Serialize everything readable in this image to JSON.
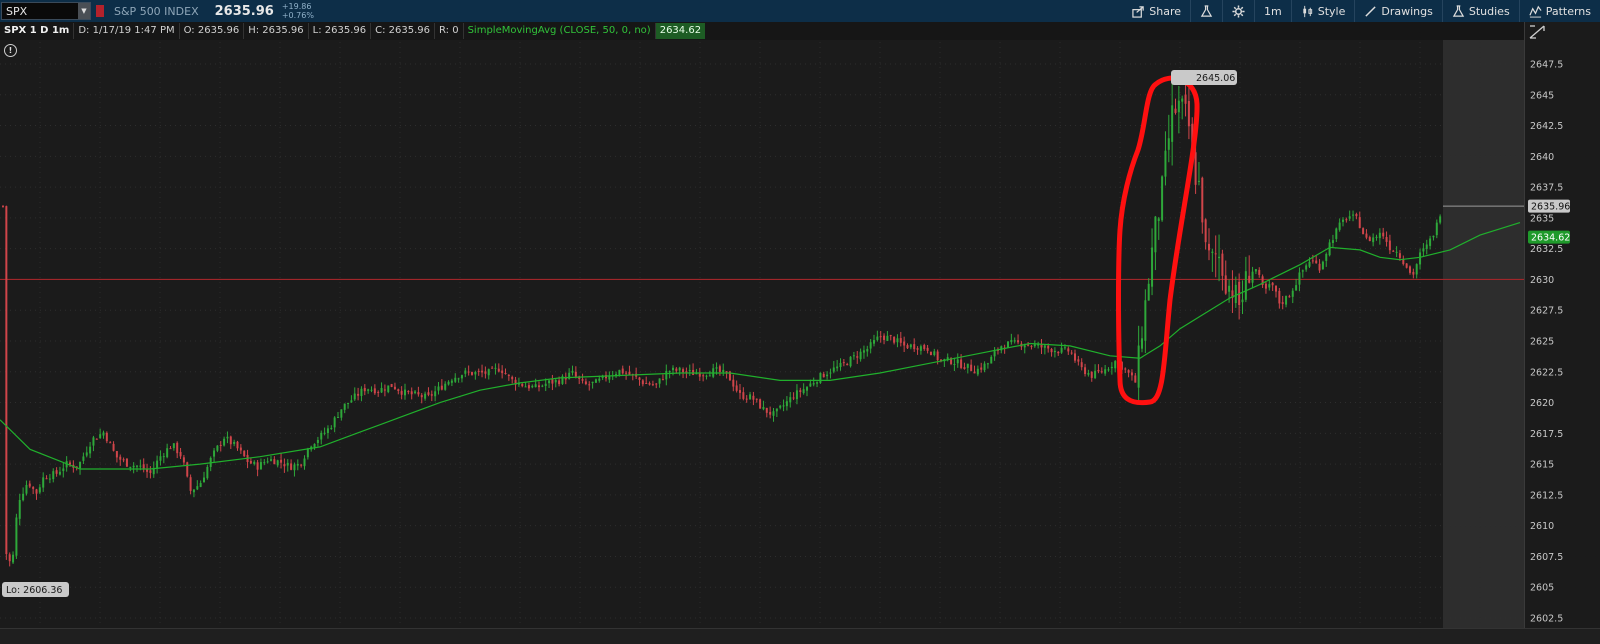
{
  "toolbar": {
    "symbol": "SPX",
    "index_name": "S&P 500 INDEX",
    "price": "2635.96",
    "change_abs": "+19.86",
    "change_pct": "+0.76%",
    "buttons": {
      "share": "Share",
      "interval": "1m",
      "style": "Style",
      "drawings": "Drawings",
      "studies": "Studies",
      "patterns": "Patterns"
    }
  },
  "infobar": {
    "title": "SPX 1 D 1m",
    "date": "D: 1/17/19 1:47 PM",
    "open": "O: 2635.96",
    "high": "H: 2635.96",
    "low": "L: 2635.96",
    "close": "C: 2635.96",
    "range": "R: 0",
    "study_label": "SimpleMovingAvg (CLOSE, 50, 0, no)",
    "study_value": "2634.62"
  },
  "info_icon": "!",
  "colors": {
    "up": "#2ea83a",
    "down": "#d0454a",
    "sma": "#20b02c",
    "hline": "#a0262a",
    "annotation": "#ff1010",
    "last_price_tag": "#c9c9c9",
    "sma_tag": "#1f9a2b"
  },
  "chart_data": {
    "type": "candlestick",
    "y_ticks": [
      "2647.5",
      "2645",
      "2642.5",
      "2640",
      "2637.5",
      "2635",
      "2632.5",
      "2630",
      "2627.5",
      "2625",
      "2622.5",
      "2620",
      "2617.5",
      "2615",
      "2612.5",
      "2610",
      "2607.5",
      "2605",
      "2602.5"
    ],
    "ylim": [
      2602.5,
      2647.5
    ],
    "high_label": "2645.06",
    "low_label": "Lo: 2606.36",
    "last_price_label": "2635.96",
    "sma_label": "2634.62",
    "horizontal_line": 2630,
    "sma_series": [
      [
        0,
        2618.6
      ],
      [
        30,
        2616.2
      ],
      [
        80,
        2614.6
      ],
      [
        150,
        2614.6
      ],
      [
        200,
        2615.0
      ],
      [
        260,
        2615.6
      ],
      [
        320,
        2616.4
      ],
      [
        360,
        2617.6
      ],
      [
        400,
        2618.8
      ],
      [
        440,
        2620.0
      ],
      [
        480,
        2621.0
      ],
      [
        520,
        2621.6
      ],
      [
        560,
        2622.0
      ],
      [
        620,
        2622.2
      ],
      [
        680,
        2622.4
      ],
      [
        730,
        2622.4
      ],
      [
        780,
        2621.8
      ],
      [
        830,
        2621.8
      ],
      [
        880,
        2622.4
      ],
      [
        930,
        2623.2
      ],
      [
        980,
        2624.0
      ],
      [
        1030,
        2624.8
      ],
      [
        1070,
        2624.6
      ],
      [
        1110,
        2623.8
      ],
      [
        1140,
        2623.6
      ],
      [
        1160,
        2624.6
      ],
      [
        1180,
        2626.0
      ],
      [
        1200,
        2627.0
      ],
      [
        1230,
        2628.5
      ],
      [
        1260,
        2629.6
      ],
      [
        1300,
        2631.2
      ],
      [
        1330,
        2632.6
      ],
      [
        1360,
        2632.4
      ],
      [
        1380,
        2631.8
      ],
      [
        1400,
        2631.6
      ],
      [
        1420,
        2631.8
      ],
      [
        1450,
        2632.4
      ],
      [
        1480,
        2633.6
      ],
      [
        1520,
        2634.62
      ]
    ],
    "price_path": [
      [
        5,
        2608
      ],
      [
        12,
        2606.6
      ],
      [
        18,
        2612
      ],
      [
        28,
        2613.6
      ],
      [
        36,
        2612.6
      ],
      [
        44,
        2614.0
      ],
      [
        56,
        2614.2
      ],
      [
        66,
        2615.0
      ],
      [
        78,
        2614.8
      ],
      [
        92,
        2617.0
      ],
      [
        104,
        2617.6
      ],
      [
        116,
        2615.6
      ],
      [
        128,
        2615.0
      ],
      [
        140,
        2614.8
      ],
      [
        150,
        2614.2
      ],
      [
        160,
        2615.6
      ],
      [
        172,
        2616.6
      ],
      [
        182,
        2615.6
      ],
      [
        190,
        2612.8
      ],
      [
        200,
        2613.4
      ],
      [
        212,
        2615.6
      ],
      [
        224,
        2617.2
      ],
      [
        236,
        2616.4
      ],
      [
        248,
        2615.2
      ],
      [
        258,
        2614.8
      ],
      [
        268,
        2615.4
      ],
      [
        280,
        2615.2
      ],
      [
        290,
        2614.8
      ],
      [
        300,
        2615.0
      ],
      [
        310,
        2616.6
      ],
      [
        320,
        2617.2
      ],
      [
        330,
        2618.0
      ],
      [
        342,
        2619.6
      ],
      [
        354,
        2620.4
      ],
      [
        366,
        2621.2
      ],
      [
        378,
        2621.0
      ],
      [
        392,
        2621.4
      ],
      [
        404,
        2620.8
      ],
      [
        416,
        2620.6
      ],
      [
        428,
        2620.4
      ],
      [
        440,
        2621.2
      ],
      [
        452,
        2622.0
      ],
      [
        464,
        2622.4
      ],
      [
        476,
        2622.4
      ],
      [
        488,
        2622.4
      ],
      [
        500,
        2622.8
      ],
      [
        512,
        2621.8
      ],
      [
        524,
        2621.4
      ],
      [
        536,
        2621.2
      ],
      [
        548,
        2621.6
      ],
      [
        560,
        2621.8
      ],
      [
        572,
        2622.4
      ],
      [
        584,
        2621.4
      ],
      [
        596,
        2621.6
      ],
      [
        608,
        2622.2
      ],
      [
        620,
        2622.6
      ],
      [
        632,
        2622.2
      ],
      [
        644,
        2621.6
      ],
      [
        656,
        2621.4
      ],
      [
        668,
        2622.6
      ],
      [
        680,
        2622.6
      ],
      [
        692,
        2622.4
      ],
      [
        704,
        2622.4
      ],
      [
        716,
        2622.6
      ],
      [
        728,
        2622.2
      ],
      [
        740,
        2620.6
      ],
      [
        752,
        2620.4
      ],
      [
        764,
        2619.4
      ],
      [
        774,
        2619.0
      ],
      [
        784,
        2619.8
      ],
      [
        794,
        2620.6
      ],
      [
        806,
        2621.2
      ],
      [
        818,
        2622.0
      ],
      [
        830,
        2622.6
      ],
      [
        842,
        2623.0
      ],
      [
        856,
        2623.8
      ],
      [
        868,
        2624.4
      ],
      [
        880,
        2625.4
      ],
      [
        892,
        2625.2
      ],
      [
        904,
        2624.6
      ],
      [
        916,
        2624.6
      ],
      [
        928,
        2624.4
      ],
      [
        940,
        2623.4
      ],
      [
        952,
        2623.4
      ],
      [
        964,
        2623.0
      ],
      [
        976,
        2622.6
      ],
      [
        988,
        2623.2
      ],
      [
        1000,
        2624.6
      ],
      [
        1012,
        2624.8
      ],
      [
        1024,
        2624.8
      ],
      [
        1036,
        2624.6
      ],
      [
        1048,
        2624.4
      ],
      [
        1060,
        2624.2
      ],
      [
        1070,
        2624.2
      ],
      [
        1080,
        2622.8
      ],
      [
        1092,
        2622.2
      ],
      [
        1104,
        2622.6
      ],
      [
        1116,
        2623.4
      ],
      [
        1126,
        2622.6
      ],
      [
        1136,
        2621.6
      ],
      [
        1142,
        2626.0
      ],
      [
        1148,
        2629.6
      ],
      [
        1154,
        2633.6
      ],
      [
        1160,
        2636.0
      ],
      [
        1166,
        2639.8
      ],
      [
        1172,
        2643.4
      ],
      [
        1180,
        2644.2
      ],
      [
        1188,
        2643.0
      ],
      [
        1194,
        2638.8
      ],
      [
        1200,
        2637.4
      ],
      [
        1206,
        2632.0
      ],
      [
        1212,
        2631.6
      ],
      [
        1218,
        2632.2
      ],
      [
        1226,
        2629.8
      ],
      [
        1234,
        2629.0
      ],
      [
        1240,
        2627.8
      ],
      [
        1248,
        2630.6
      ],
      [
        1256,
        2630.8
      ],
      [
        1264,
        2629.0
      ],
      [
        1272,
        2629.6
      ],
      [
        1280,
        2628.0
      ],
      [
        1290,
        2628.8
      ],
      [
        1300,
        2630.4
      ],
      [
        1310,
        2631.6
      ],
      [
        1320,
        2631.0
      ],
      [
        1330,
        2633.0
      ],
      [
        1338,
        2634.2
      ],
      [
        1348,
        2635.2
      ],
      [
        1358,
        2634.8
      ],
      [
        1366,
        2633.2
      ],
      [
        1374,
        2633.4
      ],
      [
        1382,
        2633.8
      ],
      [
        1390,
        2632.6
      ],
      [
        1398,
        2632.2
      ],
      [
        1406,
        2631.2
      ],
      [
        1412,
        2630.2
      ],
      [
        1420,
        2632.0
      ],
      [
        1428,
        2632.8
      ],
      [
        1436,
        2634.2
      ],
      [
        1442,
        2635.96
      ],
      [
        1462,
        2635.96
      ]
    ],
    "annotation": "hand-drawn red loop around the spike"
  }
}
